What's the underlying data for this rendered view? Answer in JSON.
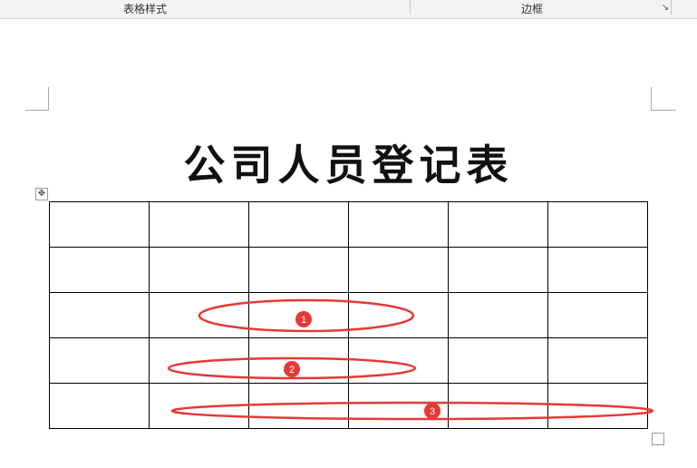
{
  "ribbon": {
    "group_table_styles": "表格样式",
    "group_borders": "边框",
    "launcher_icon": "dialog-launcher-icon"
  },
  "document": {
    "title": "公司人员登记表",
    "table": {
      "rows": 5,
      "columns": 6,
      "cells": [
        [
          "",
          "",
          "",
          "",
          "",
          ""
        ],
        [
          "",
          "",
          "",
          "",
          "",
          ""
        ],
        [
          "",
          "",
          "",
          "",
          "",
          ""
        ],
        [
          "",
          "",
          "",
          "",
          "",
          ""
        ],
        [
          "",
          "",
          "",
          "",
          "",
          ""
        ]
      ]
    }
  },
  "annotations": {
    "color": "#e53935",
    "markers": [
      {
        "label": "1"
      },
      {
        "label": "2"
      },
      {
        "label": "3"
      }
    ]
  }
}
